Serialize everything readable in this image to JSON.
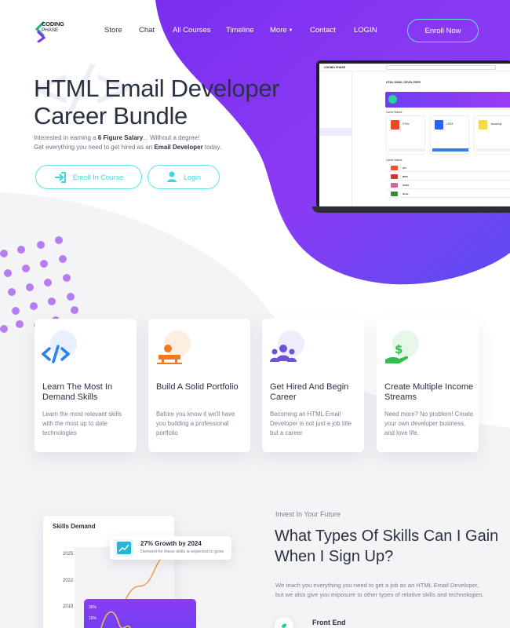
{
  "brand": {
    "logo_line1": "CODING",
    "logo_line2": "PHASE",
    "accent_purple": "#7a37f2",
    "accent_teal": "#5fe3e8"
  },
  "nav": {
    "items": [
      "Store",
      "Chat",
      "All Courses",
      "Timeline",
      "More",
      "Contact",
      "LOGIN"
    ],
    "enroll_label": "Enroll Now"
  },
  "hero": {
    "watermark": "</>",
    "title": "HTML Email Developer Career Bundle",
    "sub1_prefix": "Interested in earning a ",
    "sub1_bold": "6 Figure Salary",
    "sub1_suffix": "... Without a degree!",
    "sub2_prefix": "Get everything you need to get hired as an ",
    "sub2_bold": "Email Developer",
    "sub2_suffix": " today.",
    "enroll_course_label": "Enroll In Course",
    "login_label": "Login"
  },
  "laptop_screen": {
    "brand": "CODING PHASE",
    "heading": "HTML EMAIL DEVELOPER",
    "section1": "Career Bundle",
    "cards": [
      "HTML",
      "CSS3",
      "Javascript"
    ],
    "section2": "Career Bundle",
    "rows": [
      "GIT",
      "NPM",
      "SASS",
      "Node"
    ]
  },
  "features": [
    {
      "icon": "code-brackets-icon",
      "title": "Learn The Most In Demand Skills",
      "text": "Learn the most relevant skills with the most up to date technologies",
      "color": "#2e7ff0"
    },
    {
      "icon": "person-desk-icon",
      "title": "Build A Solid Portfolio",
      "text": "Before you know it we'll have you building a professional portfolio",
      "color": "#f07a1d"
    },
    {
      "icon": "group-people-icon",
      "title": "Get Hired And Begin Career",
      "text": "Becoming an HTML Email Developer is not just a job title but a career",
      "color": "#6b52d6"
    },
    {
      "icon": "money-hand-icon",
      "title": "Create Multiple Income Streams",
      "text": "Need more? No problem! Create your own developer business, and love life.",
      "color": "#2fbf4a"
    }
  ],
  "chart_data": {
    "type": "line",
    "title": "Skills Demand",
    "y_tick_labels": [
      "2025",
      "2022",
      "2019"
    ],
    "series": [
      {
        "values": [
          0.05,
          0.3,
          0.6,
          0.95
        ]
      }
    ],
    "callout_title": "27% Growth by 2024",
    "callout_sub": "Demand for these skills is expected to grow",
    "inner_labels": [
      "35%",
      "15%"
    ]
  },
  "skills_section": {
    "eyebrow": "Invest In Your Future",
    "title": "What Types Of Skills Can I Gain When I Sign Up?",
    "text": "We teach you everything you need to get a job as an HTML Email Developer, but we also give you exposure to other types of relative skills and technologies.",
    "first_item": "Front End"
  }
}
